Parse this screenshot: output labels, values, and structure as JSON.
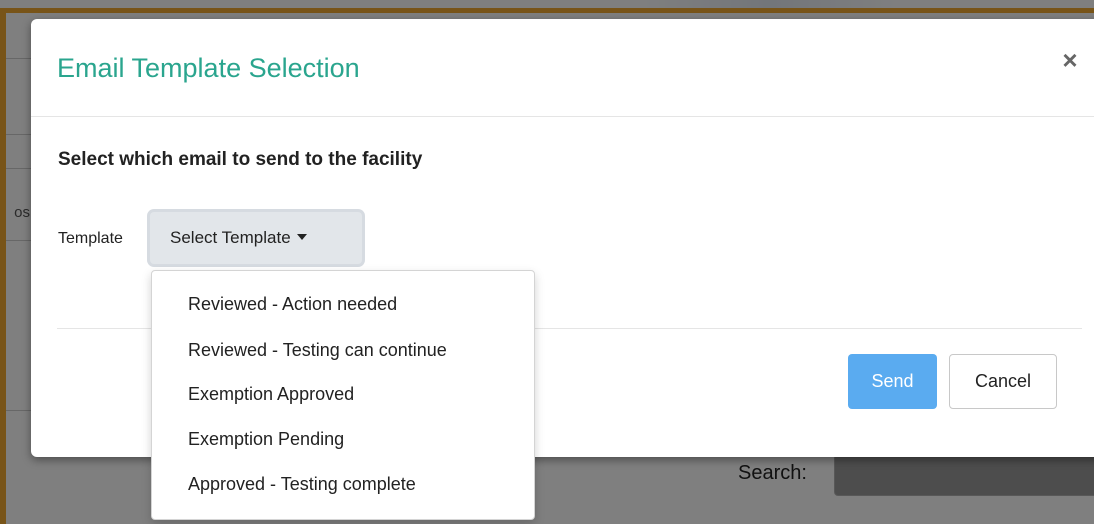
{
  "modal": {
    "title": "Email Template Selection",
    "close_label": "×",
    "subtitle": "Select which email to send to the facility",
    "template_label": "Template",
    "template_button_label": "Select Template",
    "send_label": "Send",
    "cancel_label": "Cancel"
  },
  "dropdown": {
    "items": [
      {
        "label": "Reviewed - Action needed"
      },
      {
        "label": "Reviewed - Testing can continue"
      },
      {
        "label": "Exemption Approved"
      },
      {
        "label": "Exemption Pending"
      },
      {
        "label": "Approved - Testing complete"
      }
    ]
  },
  "background": {
    "partial_text": "os",
    "search_label": "Search:"
  },
  "colors": {
    "title": "#2aa58e",
    "send_button": "#5aabf0",
    "frame_border": "#f0a830"
  }
}
